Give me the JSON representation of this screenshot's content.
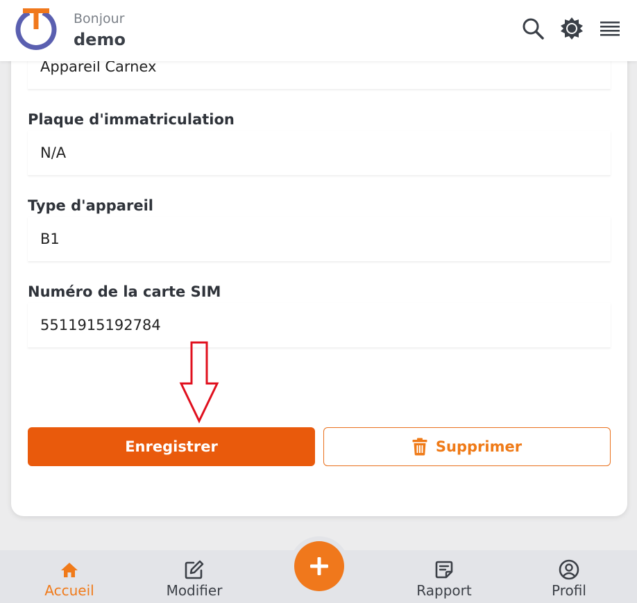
{
  "header": {
    "greeting": "Bonjour",
    "username": "demo",
    "icons": [
      "search-icon",
      "brightness-icon",
      "menu-icon"
    ]
  },
  "form": {
    "fields": [
      {
        "label": "",
        "value": "Appareil Carnex"
      },
      {
        "label": "Plaque d'immatriculation",
        "value": "N/A"
      },
      {
        "label": "Type d'appareil",
        "value": "B1"
      },
      {
        "label": "Numéro de la carte SIM",
        "value": "5511915192784"
      }
    ],
    "save_label": "Enregistrer",
    "delete_label": "Supprimer"
  },
  "bottom_nav": {
    "items": [
      {
        "label": "Accueil",
        "icon": "home-icon",
        "active": true
      },
      {
        "label": "Modifier",
        "icon": "edit-icon",
        "active": false
      },
      {
        "label": "Rapport",
        "icon": "report-icon",
        "active": false
      },
      {
        "label": "Profil",
        "icon": "profile-icon",
        "active": false
      }
    ],
    "fab_icon": "plus-icon"
  },
  "colors": {
    "accent": "#e95a0c",
    "accent_light": "#f0781c",
    "logo_ring": "#5a5fb0",
    "annotation_arrow": "#e0101e"
  }
}
